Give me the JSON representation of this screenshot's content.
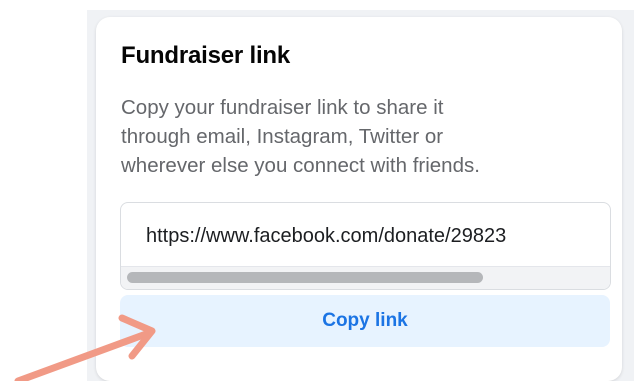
{
  "card": {
    "title": "Fundraiser link",
    "description_lines": [
      "Copy your fundraiser link to share it",
      "through email, Instagram, Twitter or",
      "wherever else you connect with friends."
    ],
    "link_value": "https://www.facebook.com/donate/29823",
    "copy_button_label": "Copy link"
  },
  "colors": {
    "accent": "#1b74e4",
    "button_bg": "#e7f3ff",
    "annotation_arrow": "#f19a86"
  }
}
